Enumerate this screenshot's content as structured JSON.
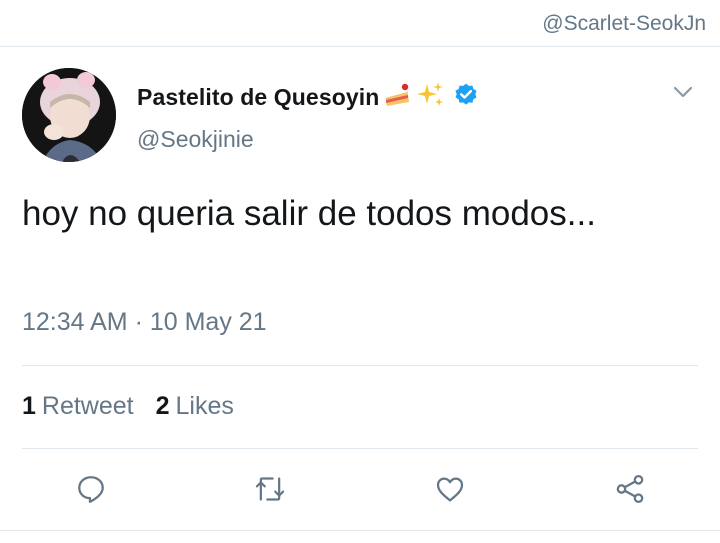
{
  "watermark": "@Scarlet-SeokJn",
  "tweet": {
    "display_name": "Pastelito de Quesoyin",
    "display_name_emojis": [
      "cake-emoji",
      "sparkles-emoji"
    ],
    "verified": true,
    "handle": "@Seokjinie",
    "text": "hoy no queria salir de todos modos...",
    "timestamp": "12:34 AM · 10 May 21"
  },
  "stats": {
    "retweets_count": "1",
    "retweets_label": "Retweet",
    "likes_count": "2",
    "likes_label": "Likes"
  },
  "actions": [
    {
      "name": "reply-icon"
    },
    {
      "name": "retweet-icon"
    },
    {
      "name": "like-icon"
    },
    {
      "name": "share-icon"
    }
  ],
  "colors": {
    "text_primary": "#14171a",
    "text_secondary": "#657786",
    "verified_blue": "#1da1f2",
    "divider": "#e1e8ed"
  }
}
